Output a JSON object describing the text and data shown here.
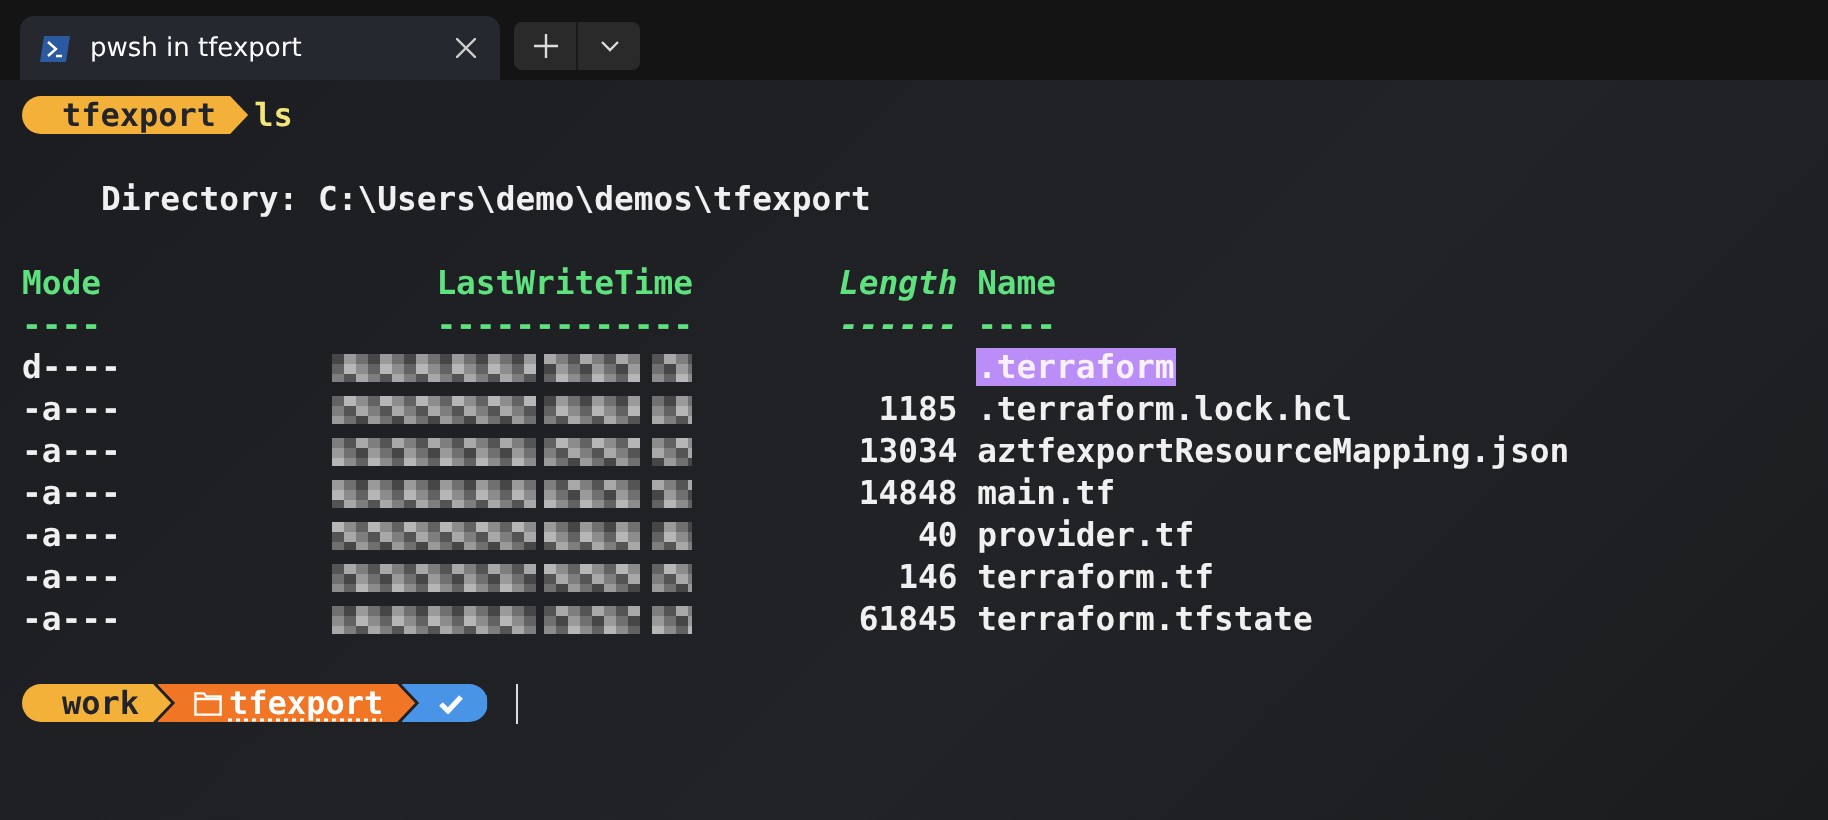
{
  "tabs": [
    {
      "title": "pwsh in tfexport",
      "selected": true
    }
  ],
  "first_prompt": {
    "segments": [
      {
        "kind": "text",
        "text": "tfexport",
        "color": "#f3b13a"
      }
    ],
    "command": "ls"
  },
  "directory": "Directory: C:\\Users\\demo\\demos\\tfexport",
  "columns": [
    {
      "label": "Mode",
      "rule": "----"
    },
    {
      "label": "LastWriteTime",
      "rule": "-------------"
    },
    {
      "label": "Length",
      "rule": "------"
    },
    {
      "label": "Name",
      "rule": "----"
    }
  ],
  "rows": [
    {
      "mode": "d----",
      "length": "",
      "name": ".terraform",
      "kind": "directory"
    },
    {
      "mode": "-a---",
      "length": "1185",
      "name": ".terraform.lock.hcl",
      "kind": "file"
    },
    {
      "mode": "-a---",
      "length": "13034",
      "name": "aztfexportResourceMapping.json",
      "kind": "file"
    },
    {
      "mode": "-a---",
      "length": "14848",
      "name": "main.tf",
      "kind": "file"
    },
    {
      "mode": "-a---",
      "length": "40",
      "name": "provider.tf",
      "kind": "file"
    },
    {
      "mode": "-a---",
      "length": "146",
      "name": "terraform.tf",
      "kind": "file"
    },
    {
      "mode": "-a---",
      "length": "61845",
      "name": "terraform.tfstate",
      "kind": "file"
    }
  ],
  "second_prompt": {
    "segments": [
      {
        "kind": "text",
        "text": "work",
        "color": "#f3b13a"
      },
      {
        "kind": "folder",
        "text": "tfexport",
        "color": "#f07524"
      },
      {
        "kind": "status",
        "color": "#4a94e8"
      }
    ]
  }
}
